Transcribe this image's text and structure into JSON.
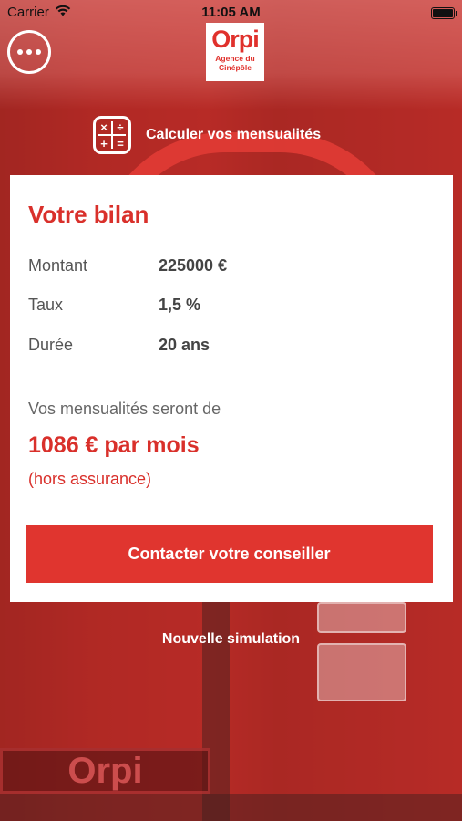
{
  "status_bar": {
    "carrier": "Carrier",
    "time": "11:05 AM"
  },
  "header": {
    "logo_text": "Orpi",
    "logo_sub_line1": "Agence du",
    "logo_sub_line2": "Cinépôle",
    "calculator_title": "Calculer vos mensualités"
  },
  "card": {
    "title": "Votre bilan",
    "rows": [
      {
        "label": "Montant",
        "value": "225000 €"
      },
      {
        "label": "Taux",
        "value": "1,5 %"
      },
      {
        "label": "Durée",
        "value": "20 ans"
      }
    ],
    "intro": "Vos mensualités seront de",
    "monthly": "1086 € par mois",
    "note": "(hors assurance)",
    "contact_button": "Contacter votre conseiller"
  },
  "footer": {
    "new_simulation": "Nouvelle simulation"
  },
  "colors": {
    "accent": "#e0352f",
    "title_red": "#d9302b"
  }
}
